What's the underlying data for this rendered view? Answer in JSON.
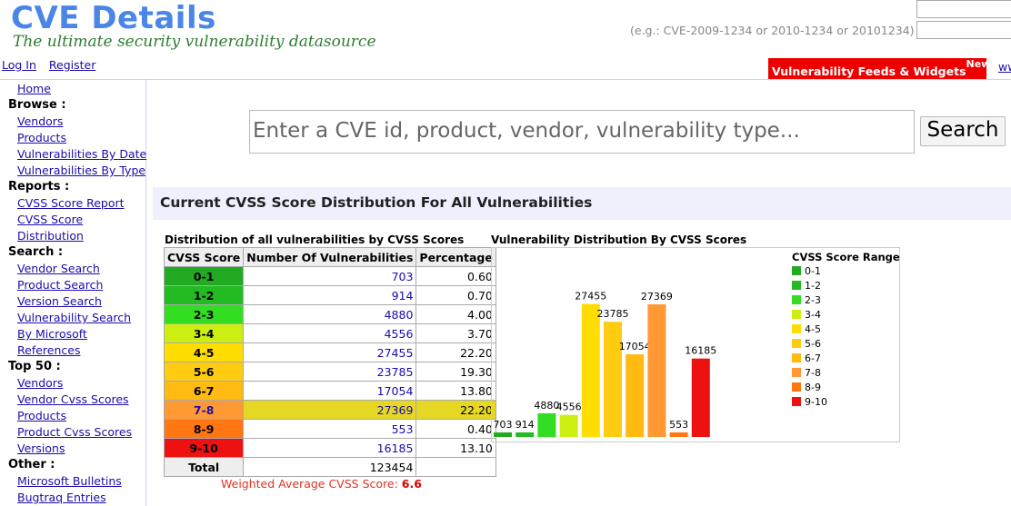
{
  "header": {
    "logo": "CVE Details",
    "tagline": "The ultimate security vulnerability datasource",
    "hint": "(e.g.: CVE-2009-1234 or 2010-1234 or 20101234)",
    "login": "Log In",
    "register": "Register",
    "feeds": "Vulnerability Feeds & Widgets",
    "feeds_badge": "New",
    "ww": "ww"
  },
  "sidebar": {
    "home": "Home",
    "browse": "Browse :",
    "browse_items": [
      "Vendors",
      "Products",
      "Vulnerabilities By Date",
      "Vulnerabilities By Type"
    ],
    "reports": "Reports :",
    "reports_items": [
      "CVSS Score Report",
      "CVSS Score",
      "Distribution"
    ],
    "search": "Search :",
    "search_items": [
      "Vendor Search",
      "Product Search",
      "Version Search",
      "Vulnerability Search",
      "By Microsoft",
      "References"
    ],
    "top50": "Top 50 :",
    "top50_items": [
      "Vendors",
      "Vendor Cvss Scores",
      "Products",
      "Product Cvss Scores",
      "Versions"
    ],
    "other": "Other :",
    "other_items": [
      "Microsoft Bulletins",
      "Bugtraq Entries"
    ]
  },
  "search": {
    "placeholder": "Enter a CVE id, product, vendor, vulnerability type...",
    "button": "Search"
  },
  "section_title": "Current CVSS Score Distribution For All Vulnerabilities",
  "table": {
    "title": "Distribution of all vulnerabilities by CVSS Scores",
    "headers": [
      "CVSS Score",
      "Number Of Vulnerabilities",
      "Percentage"
    ],
    "rows": [
      {
        "score": "0-1",
        "count": "703",
        "pct": "0.60",
        "color": "#22aa22"
      },
      {
        "score": "1-2",
        "count": "914",
        "pct": "0.70",
        "color": "#22bb22"
      },
      {
        "score": "2-3",
        "count": "4880",
        "pct": "4.00",
        "color": "#33dd22"
      },
      {
        "score": "3-4",
        "count": "4556",
        "pct": "3.70",
        "color": "#ccee11"
      },
      {
        "score": "4-5",
        "count": "27455",
        "pct": "22.20",
        "color": "#ffdd00"
      },
      {
        "score": "5-6",
        "count": "23785",
        "pct": "19.30",
        "color": "#ffcc11"
      },
      {
        "score": "6-7",
        "count": "17054",
        "pct": "13.80",
        "color": "#ffbb11"
      },
      {
        "score": "7-8",
        "count": "27369",
        "pct": "22.20",
        "color": "#ff9933"
      },
      {
        "score": "8-9",
        "count": "553",
        "pct": "0.40",
        "color": "#ff7711"
      },
      {
        "score": "9-10",
        "count": "16185",
        "pct": "13.10",
        "color": "#ee1111"
      }
    ],
    "total_label": "Total",
    "total_value": "123454",
    "weighted_label": "Weighted Average CVSS Score:",
    "weighted_value": "6.6"
  },
  "chart_data": {
    "type": "bar",
    "title": "Vulnerability Distribution By CVSS Scores",
    "legend_title": "CVSS Score Ranges",
    "legend_position": "top-right",
    "categories": [
      "0-1",
      "1-2",
      "2-3",
      "3-4",
      "4-5",
      "5-6",
      "6-7",
      "7-8",
      "8-9",
      "9-10"
    ],
    "values": [
      703,
      914,
      4880,
      4556,
      27455,
      23785,
      17054,
      27369,
      553,
      16185
    ],
    "colors": [
      "#22aa22",
      "#22bb22",
      "#33dd22",
      "#ccee11",
      "#ffdd00",
      "#ffcc11",
      "#ffbb11",
      "#ff9933",
      "#ff7711",
      "#ee1111"
    ],
    "ylim": [
      0,
      30000
    ],
    "grid": false
  }
}
